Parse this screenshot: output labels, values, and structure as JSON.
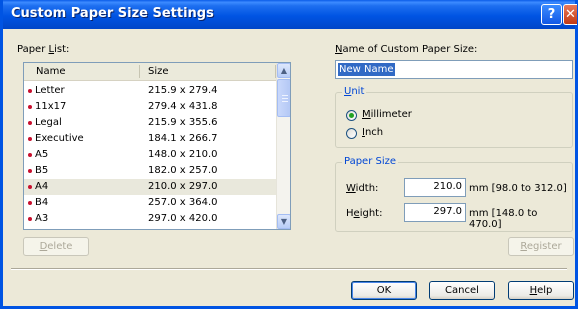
{
  "window": {
    "title": "Custom Paper Size Settings",
    "help": "?",
    "close": "✕"
  },
  "paper_list": {
    "label_prefix": "Paper ",
    "label_accel": "L",
    "label_suffix": "ist:",
    "columns": [
      "Name",
      "Size"
    ],
    "rows": [
      {
        "name": "Letter",
        "size": "215.9 x 279.4"
      },
      {
        "name": "11x17",
        "size": "279.4 x 431.8"
      },
      {
        "name": "Legal",
        "size": "215.9 x 355.6"
      },
      {
        "name": "Executive",
        "size": "184.1 x 266.7"
      },
      {
        "name": "A5",
        "size": "148.0 x 210.0"
      },
      {
        "name": "B5",
        "size": "182.0 x 257.0"
      },
      {
        "name": "A4",
        "size": "210.0 x 297.0"
      },
      {
        "name": "B4",
        "size": "257.0 x 364.0"
      },
      {
        "name": "A3",
        "size": "297.0 x 420.0"
      }
    ],
    "selected_index": 6,
    "delete_accel": "D",
    "delete_rest": "elete"
  },
  "custom_name": {
    "label_accel": "N",
    "label_rest": "ame of Custom Paper Size:",
    "value": "New Name"
  },
  "unit": {
    "title_accel": "U",
    "title_rest": "nit",
    "options": [
      {
        "accel": "M",
        "rest": "illimeter",
        "selected": true
      },
      {
        "accel": "I",
        "rest": "nch",
        "selected": false
      }
    ]
  },
  "paper_size": {
    "title": "Paper Size",
    "width_accel": "W",
    "width_rest": "idth:",
    "width_value": "210.0",
    "width_range": "mm [98.0 to 312.0]",
    "height_pre": "H",
    "height_accel": "e",
    "height_rest": "ight:",
    "height_value": "297.0",
    "height_range": "mm [148.0 to 470.0]"
  },
  "register": {
    "accel": "R",
    "rest": "egister"
  },
  "buttons": {
    "ok": "OK",
    "cancel": "Cancel",
    "help_accel": "H",
    "help_rest": "elp"
  }
}
